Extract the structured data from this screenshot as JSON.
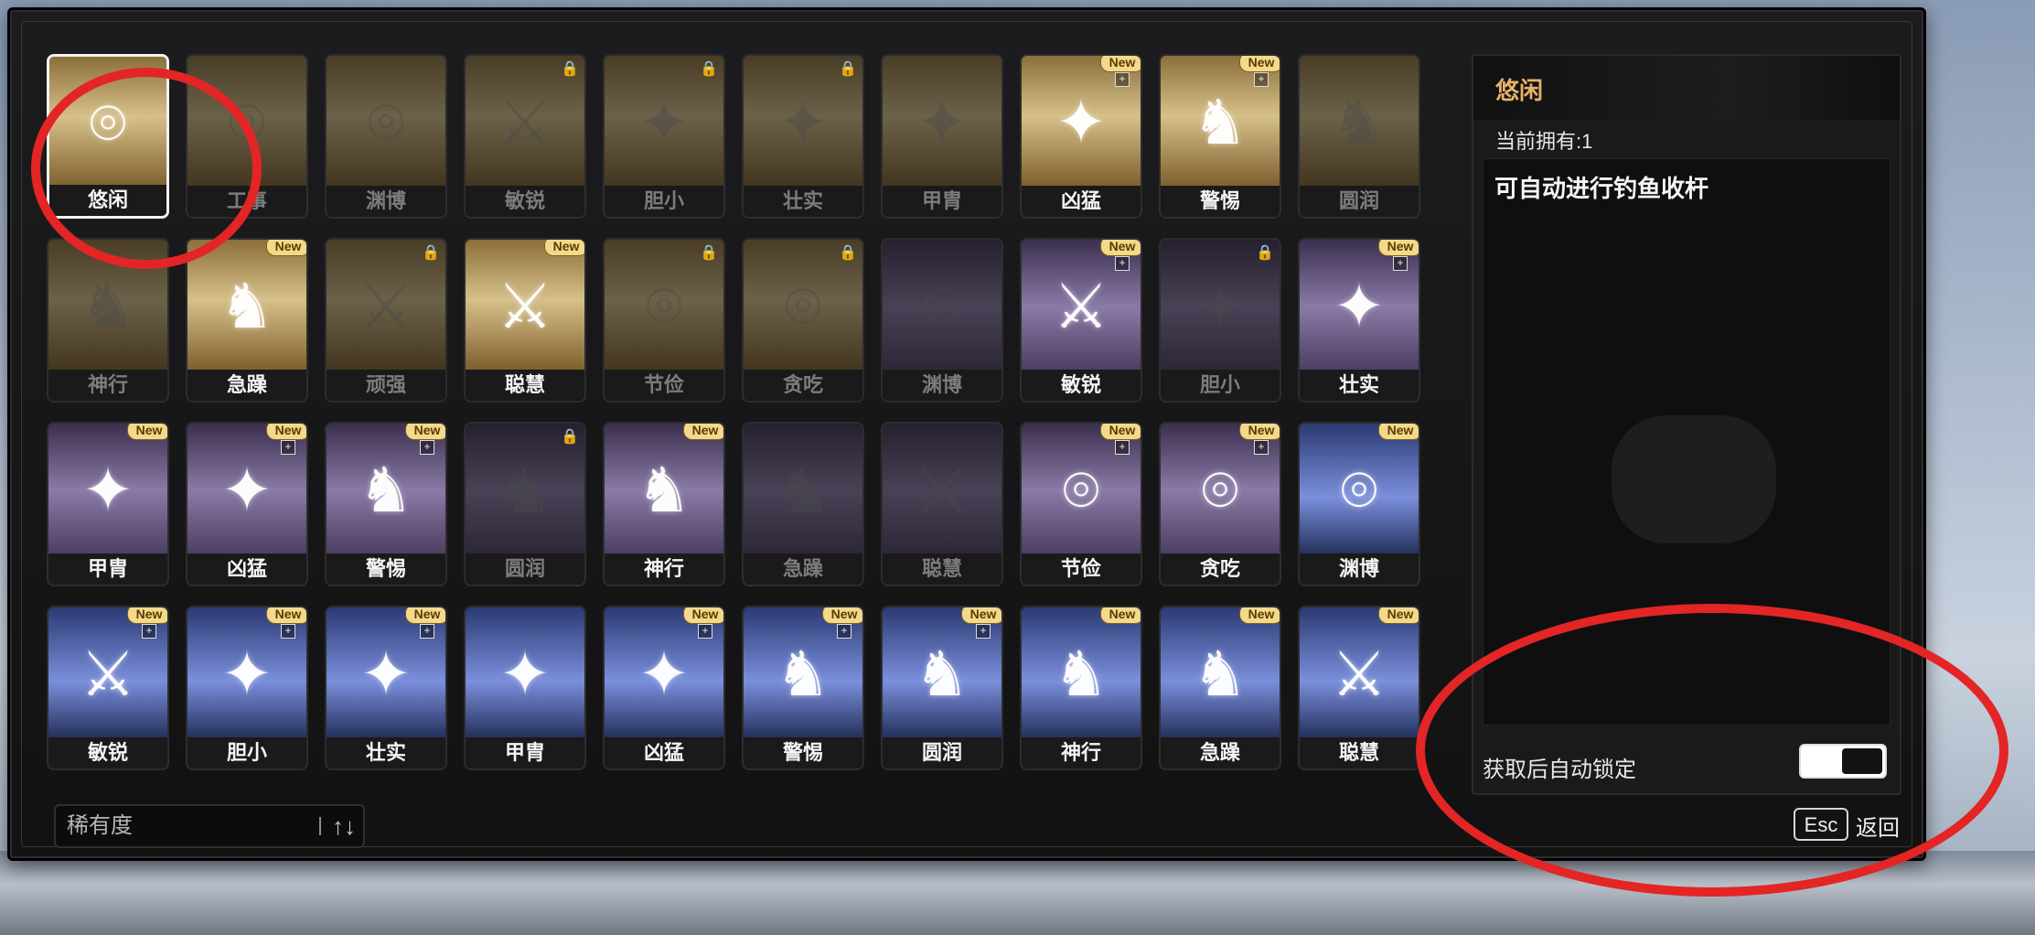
{
  "cards": [
    [
      {
        "label": "悠闲",
        "icon": "compass",
        "locked": false,
        "new": false,
        "plus": false,
        "tone": "gold",
        "selected": true
      },
      {
        "label": "工事",
        "icon": "compass",
        "locked": true,
        "new": false,
        "plus": false,
        "tone": "gold"
      },
      {
        "label": "渊博",
        "icon": "compass",
        "locked": true,
        "new": false,
        "plus": false,
        "tone": "gold"
      },
      {
        "label": "敏锐",
        "icon": "sword",
        "locked": true,
        "new": false,
        "plus": false,
        "tone": "gold",
        "lock": true
      },
      {
        "label": "胆小",
        "icon": "star",
        "locked": true,
        "new": false,
        "plus": false,
        "tone": "gold",
        "lock": true
      },
      {
        "label": "壮实",
        "icon": "star",
        "locked": true,
        "new": false,
        "plus": false,
        "tone": "gold",
        "lock": true
      },
      {
        "label": "甲胄",
        "icon": "star",
        "locked": true,
        "new": false,
        "plus": false,
        "tone": "gold"
      },
      {
        "label": "凶猛",
        "icon": "star",
        "locked": false,
        "new": true,
        "plus": true,
        "tone": "gold"
      },
      {
        "label": "警惕",
        "icon": "horse",
        "locked": false,
        "new": true,
        "plus": true,
        "tone": "gold"
      },
      {
        "label": "圆润",
        "icon": "horse",
        "locked": true,
        "new": false,
        "plus": false,
        "tone": "gold"
      }
    ],
    [
      {
        "label": "神行",
        "icon": "horse",
        "locked": true,
        "new": false,
        "plus": false,
        "tone": "gold"
      },
      {
        "label": "急躁",
        "icon": "horse",
        "locked": false,
        "new": true,
        "plus": false,
        "tone": "gold"
      },
      {
        "label": "顽强",
        "icon": "sword",
        "locked": true,
        "new": false,
        "plus": false,
        "tone": "gold",
        "lock": true
      },
      {
        "label": "聪慧",
        "icon": "sword",
        "locked": false,
        "new": true,
        "plus": false,
        "tone": "gold"
      },
      {
        "label": "节俭",
        "icon": "compass",
        "locked": true,
        "new": false,
        "plus": false,
        "tone": "gold",
        "lock": true
      },
      {
        "label": "贪吃",
        "icon": "compass",
        "locked": true,
        "new": false,
        "plus": false,
        "tone": "gold",
        "lock": true
      },
      {
        "label": "渊博",
        "icon": "compass",
        "locked": true,
        "new": false,
        "plus": false,
        "tone": "purple"
      },
      {
        "label": "敏锐",
        "icon": "sword",
        "locked": false,
        "new": true,
        "plus": true,
        "tone": "purple"
      },
      {
        "label": "胆小",
        "icon": "star",
        "locked": true,
        "new": false,
        "plus": false,
        "tone": "purple",
        "lock": true
      },
      {
        "label": "壮实",
        "icon": "star",
        "locked": false,
        "new": true,
        "plus": true,
        "tone": "purple"
      }
    ],
    [
      {
        "label": "甲胄",
        "icon": "star",
        "locked": false,
        "new": true,
        "plus": false,
        "tone": "purple"
      },
      {
        "label": "凶猛",
        "icon": "star",
        "locked": false,
        "new": true,
        "plus": true,
        "tone": "purple"
      },
      {
        "label": "警惕",
        "icon": "horse",
        "locked": false,
        "new": true,
        "plus": true,
        "tone": "purple"
      },
      {
        "label": "圆润",
        "icon": "horse",
        "locked": true,
        "new": false,
        "plus": false,
        "tone": "purple",
        "lock": true
      },
      {
        "label": "神行",
        "icon": "horse",
        "locked": false,
        "new": true,
        "plus": false,
        "tone": "purple"
      },
      {
        "label": "急躁",
        "icon": "horse",
        "locked": true,
        "new": false,
        "plus": false,
        "tone": "purple"
      },
      {
        "label": "聪慧",
        "icon": "sword",
        "locked": true,
        "new": false,
        "plus": false,
        "tone": "purple"
      },
      {
        "label": "节俭",
        "icon": "compass",
        "locked": false,
        "new": true,
        "plus": true,
        "tone": "purple"
      },
      {
        "label": "贪吃",
        "icon": "compass",
        "locked": false,
        "new": true,
        "plus": true,
        "tone": "purple"
      },
      {
        "label": "渊博",
        "icon": "compass",
        "locked": false,
        "new": true,
        "plus": false,
        "tone": "blue"
      }
    ],
    [
      {
        "label": "敏锐",
        "icon": "sword",
        "locked": false,
        "new": true,
        "plus": true,
        "tone": "blue"
      },
      {
        "label": "胆小",
        "icon": "star",
        "locked": false,
        "new": true,
        "plus": true,
        "tone": "blue"
      },
      {
        "label": "壮实",
        "icon": "star",
        "locked": false,
        "new": true,
        "plus": true,
        "tone": "blue"
      },
      {
        "label": "甲胄",
        "icon": "star",
        "locked": false,
        "new": false,
        "plus": false,
        "tone": "blue"
      },
      {
        "label": "凶猛",
        "icon": "star",
        "locked": false,
        "new": true,
        "plus": true,
        "tone": "blue"
      },
      {
        "label": "警惕",
        "icon": "horse",
        "locked": false,
        "new": true,
        "plus": true,
        "tone": "blue"
      },
      {
        "label": "圆润",
        "icon": "horse",
        "locked": false,
        "new": true,
        "plus": true,
        "tone": "blue"
      },
      {
        "label": "神行",
        "icon": "horse",
        "locked": false,
        "new": true,
        "plus": false,
        "tone": "blue"
      },
      {
        "label": "急躁",
        "icon": "horse",
        "locked": false,
        "new": true,
        "plus": false,
        "tone": "blue"
      },
      {
        "label": "聪慧",
        "icon": "sword",
        "locked": false,
        "new": true,
        "plus": false,
        "tone": "blue"
      }
    ]
  ],
  "badges": {
    "new_text": "New"
  },
  "icons": {
    "compass": "⌾",
    "sword": "⚔",
    "star": "✦",
    "horse": "♞",
    "lock": "🔒",
    "plus": "+"
  },
  "tones": {
    "gold": "linear-gradient(180deg,#8b6f3b 0%,#d6c08a 45%,#7a5b2a 100%)",
    "purple": "linear-gradient(180deg,#3b2f4f 0%,#8a7aa6 50%,#4a3b5f 100%)",
    "blue": "linear-gradient(180deg,#2b3a72 0%,#7b8fdc 55%,#1f2b55 100%)"
  },
  "sort": {
    "label": "稀有度",
    "icon": "↑↓"
  },
  "detail": {
    "title": "悠闲",
    "owned": "当前拥有:1",
    "description": "可自动进行钓鱼收杆",
    "auto_lock_label": "获取后自动锁定",
    "auto_lock_on": true
  },
  "footer": {
    "esc_key": "Esc",
    "back_label": "返回"
  }
}
